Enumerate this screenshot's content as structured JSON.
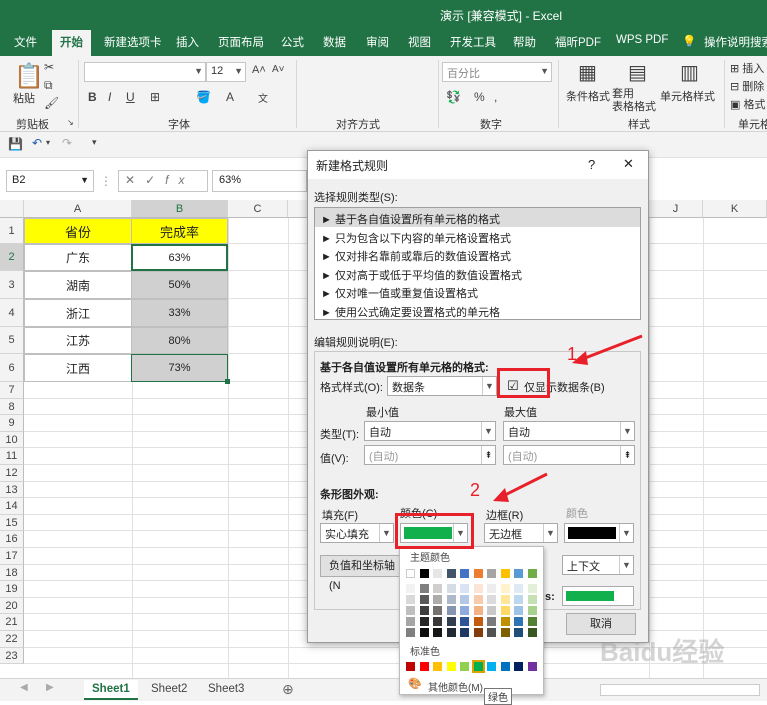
{
  "window": {
    "title": "演示 [兼容模式] - Excel"
  },
  "tabs": [
    "文件",
    "开始",
    "新建选项卡",
    "插入",
    "页面布局",
    "公式",
    "数据",
    "审阅",
    "视图",
    "开发工具",
    "帮助",
    "福昕PDF",
    "WPS PDF",
    "操作说明搜索"
  ],
  "ribbon": {
    "paste": "粘贴",
    "clipboard": "剪贴板",
    "font_group": "字体",
    "align_group": "对齐方式",
    "number_group": "数字",
    "styles_group": "样式",
    "cells_group": "单元格",
    "font_size": "12",
    "number_format": "百分比",
    "cond_format": "条件格式",
    "table_format": "套用\n表格格式",
    "cell_style": "单元格样式",
    "insert": "插入",
    "delete": "删除",
    "format": "格式"
  },
  "formula": {
    "name_box": "B2",
    "value": "63%"
  },
  "columns": [
    "A",
    "B",
    "C",
    "J",
    "K"
  ],
  "rows": [
    "1",
    "2",
    "3",
    "4",
    "5",
    "6",
    "7",
    "8",
    "9",
    "10",
    "11",
    "12",
    "13",
    "14",
    "15",
    "16",
    "17",
    "18",
    "19",
    "20",
    "21",
    "22",
    "23"
  ],
  "table": {
    "headers": [
      "省份",
      "完成率"
    ],
    "rows": [
      [
        "广东",
        "63%"
      ],
      [
        "湖南",
        "50%"
      ],
      [
        "浙江",
        "33%"
      ],
      [
        "江苏",
        "80%"
      ],
      [
        "江西",
        "73%"
      ]
    ]
  },
  "sheets": [
    "Sheet1",
    "Sheet2",
    "Sheet3"
  ],
  "dialog": {
    "title": "新建格式规则",
    "help": "?",
    "close": "✕",
    "select_rule_label": "选择规则类型(S):",
    "rules": [
      "► 基于各自值设置所有单元格的格式",
      "► 只为包含以下内容的单元格设置格式",
      "► 仅对排名靠前或靠后的数值设置格式",
      "► 仅对高于或低于平均值的数值设置格式",
      "► 仅对唯一值或重复值设置格式",
      "► 使用公式确定要设置格式的单元格"
    ],
    "edit_rule_label": "编辑规则说明(E):",
    "section_title": "基于各自值设置所有单元格的格式:",
    "format_style_label": "格式样式(O):",
    "format_style_value": "数据条",
    "show_bar_only": "仅显示数据条(B)",
    "min_label": "最小值",
    "max_label": "最大值",
    "type_label": "类型(T):",
    "min_type": "自动",
    "max_type": "自动",
    "value_label": "值(V):",
    "min_value": "(自动)",
    "max_value": "(自动)",
    "bar_appearance": "条形图外观:",
    "fill_label": "填充(F)",
    "color_label": "颜色(C)",
    "border_label": "边框(R)",
    "border_color_label": "颜色",
    "fill_value": "实心填充",
    "border_value": "无边框",
    "negative_btn": "负值和坐标轴(N",
    "direction_value": "上下文",
    "preview_suffix": "s:",
    "cancel": "取消",
    "bar_color": "#12b04c",
    "border_color": "#000000"
  },
  "annotations": {
    "step1": "1",
    "step2": "2"
  },
  "palette": {
    "theme_label": "主题颜色",
    "standard_label": "标准色",
    "more_colors": "其他颜色(M)...",
    "tooltip": "绿色",
    "theme_top": [
      "#ffffff",
      "#000000",
      "#e7e6e6",
      "#44546a",
      "#4472c4",
      "#ed7d31",
      "#a5a5a5",
      "#ffc000",
      "#5b9bd5",
      "#70ad47"
    ],
    "theme_cols": [
      [
        "#f2f2f2",
        "#d9d9d9",
        "#bfbfbf",
        "#a6a6a6",
        "#7f7f7f"
      ],
      [
        "#7f7f7f",
        "#595959",
        "#3f3f3f",
        "#262626",
        "#0c0c0c"
      ],
      [
        "#d0cece",
        "#aeabab",
        "#757171",
        "#3a3838",
        "#171616"
      ],
      [
        "#d6dce4",
        "#adb9ca",
        "#8496b0",
        "#333f4f",
        "#222a35"
      ],
      [
        "#dae3f3",
        "#b4c7e7",
        "#8faadc",
        "#2f5597",
        "#1f3864"
      ],
      [
        "#fbe5d6",
        "#f8cbad",
        "#f4b183",
        "#c55a11",
        "#843c0c"
      ],
      [
        "#ededed",
        "#dbdbdb",
        "#c9c9c9",
        "#7b7b7b",
        "#525252"
      ],
      [
        "#fff2cc",
        "#ffe699",
        "#ffd966",
        "#bf9000",
        "#7f6000"
      ],
      [
        "#deebf7",
        "#bdd7ee",
        "#9dc3e6",
        "#2e75b6",
        "#1f4e79"
      ],
      [
        "#e2f0d9",
        "#c5e0b4",
        "#a9d18e",
        "#548235",
        "#385723"
      ]
    ],
    "standard": [
      "#c00000",
      "#ff0000",
      "#ffc000",
      "#ffff00",
      "#92d050",
      "#00b050",
      "#00b0f0",
      "#0070c0",
      "#002060",
      "#7030a0"
    ]
  },
  "watermark": "Baidu经验"
}
